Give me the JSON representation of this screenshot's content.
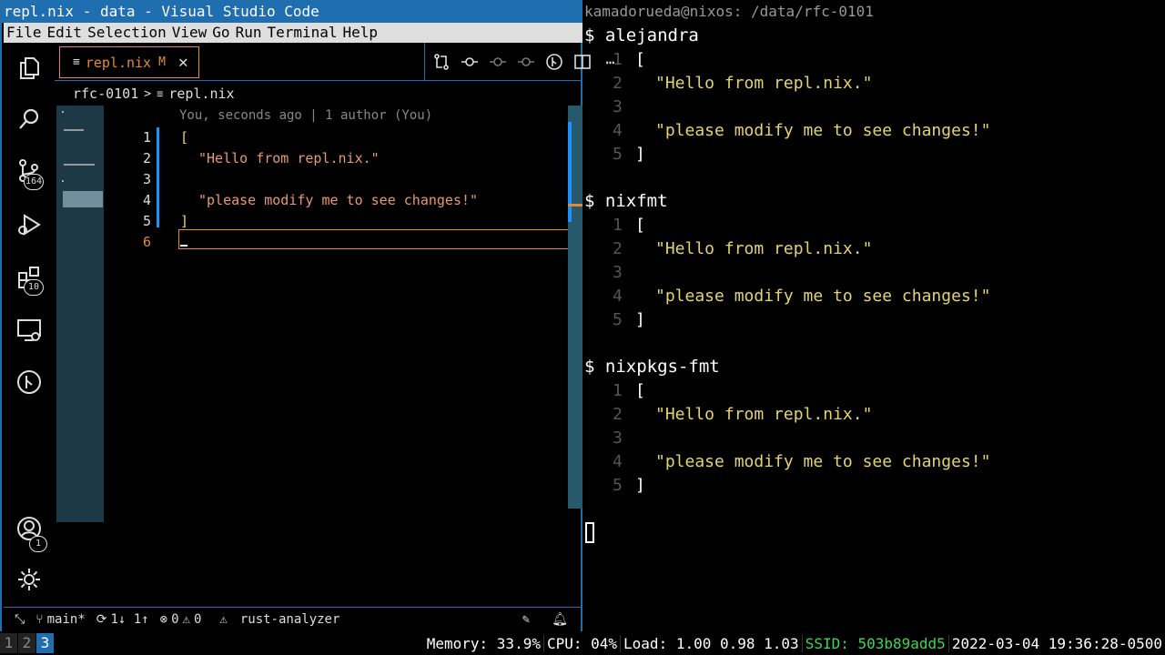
{
  "vscode": {
    "window_title": "repl.nix - data - Visual Studio Code",
    "menu": [
      "File",
      "Edit",
      "Selection",
      "View",
      "Go",
      "Run",
      "Terminal",
      "Help"
    ],
    "activity": {
      "source_control_badge": "164",
      "extensions_badge": "10",
      "accounts_badge": "1"
    },
    "tab": {
      "label": "repl.nix",
      "modified": "M"
    },
    "breadcrumb": {
      "folder": "rfc-0101",
      "sep": ">",
      "file": "repl.nix"
    },
    "blame": "You, seconds ago | 1 author (You)",
    "line_numbers": [
      "1",
      "2",
      "3",
      "4",
      "5",
      "6"
    ],
    "code_lines": [
      "[",
      "\"Hello from repl.nix.\"",
      "",
      "\"please modify me to see changes!\"",
      "]",
      ""
    ],
    "status": {
      "branch": "main*",
      "sync": "1↓ 1↑",
      "errors": "0",
      "warnings": "0",
      "lsp": "rust-analyzer"
    }
  },
  "terminal": {
    "title": "kamadorueda@nixos: /data/rfc-0101",
    "blocks": [
      {
        "prompt": "$ alejandra",
        "lines": [
          {
            "n": "1",
            "t": "["
          },
          {
            "n": "2",
            "t": "\"Hello from repl.nix.\"",
            "s": true
          },
          {
            "n": "3",
            "t": ""
          },
          {
            "n": "4",
            "t": "\"please modify me to see changes!\"",
            "s": true
          },
          {
            "n": "5",
            "t": "]"
          }
        ]
      },
      {
        "prompt": "$ nixfmt",
        "lines": [
          {
            "n": "1",
            "t": "["
          },
          {
            "n": "2",
            "t": "\"Hello from repl.nix.\"",
            "s": true
          },
          {
            "n": "3",
            "t": ""
          },
          {
            "n": "4",
            "t": "\"please modify me to see changes!\"",
            "s": true
          },
          {
            "n": "5",
            "t": "]"
          }
        ]
      },
      {
        "prompt": "$ nixpkgs-fmt",
        "lines": [
          {
            "n": "1",
            "t": "["
          },
          {
            "n": "2",
            "t": "\"Hello from repl.nix.\"",
            "s": true
          },
          {
            "n": "3",
            "t": ""
          },
          {
            "n": "4",
            "t": "\"please modify me to see changes!\"",
            "s": true
          },
          {
            "n": "5",
            "t": "]"
          }
        ]
      }
    ]
  },
  "bar": {
    "workspaces": [
      "1",
      "2",
      "3"
    ],
    "active_workspace": "3",
    "memory": "Memory: 33.9%",
    "cpu": "CPU: 04%",
    "load": "Load: 1.00 0.98 1.03",
    "ssid": "SSID: 503b89add5",
    "datetime": "2022-03-04 19:36:28-0500",
    "ssid_color": "#3fd64f"
  }
}
